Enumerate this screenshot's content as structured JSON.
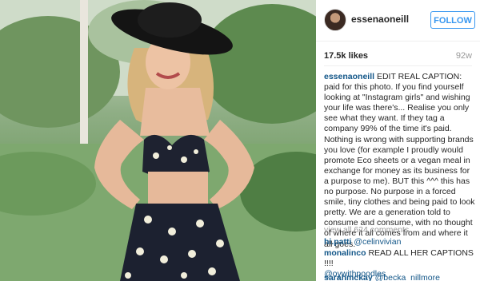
{
  "post": {
    "username": "essenaoneill",
    "follow_label": "FOLLOW",
    "likes": "17.5k likes",
    "age": "92w",
    "caption_user": "essenaoneill",
    "caption_text": "EDIT REAL CAPTION: paid for this photo. If you find yourself looking at \"Instagram girls\" and wishing your life was there's... Realise you only see what they want. If they tag a company 99% of the time it's paid. Nothing is wrong with supporting brands you love (for example I proudly would promote Eco sheets or a vegan meal in exchange for money as its business for a purpose to me). BUT this ^^^ this has no purpose. No purpose in a forced smile, tiny clothes and being paid to look pretty. We are a generation told to consume and consume, with no thought of where it all comes from and where it all goes.",
    "view_all": "view all 624 comments",
    "comments": [
      {
        "user": "hi.patti",
        "text": "",
        "mention": "@celinvivian"
      },
      {
        "user": "monalinco",
        "text": "READ ALL HER CAPTIONS !!!!",
        "mention": "@oywithpoodles"
      },
      {
        "user": "sarahmckay",
        "text": "",
        "mention": "@becka_nillmore"
      }
    ]
  },
  "colors": {
    "link": "#125688",
    "follow": "#3897f0",
    "muted": "#999999"
  },
  "icons": {
    "avatar": "profile-avatar"
  }
}
